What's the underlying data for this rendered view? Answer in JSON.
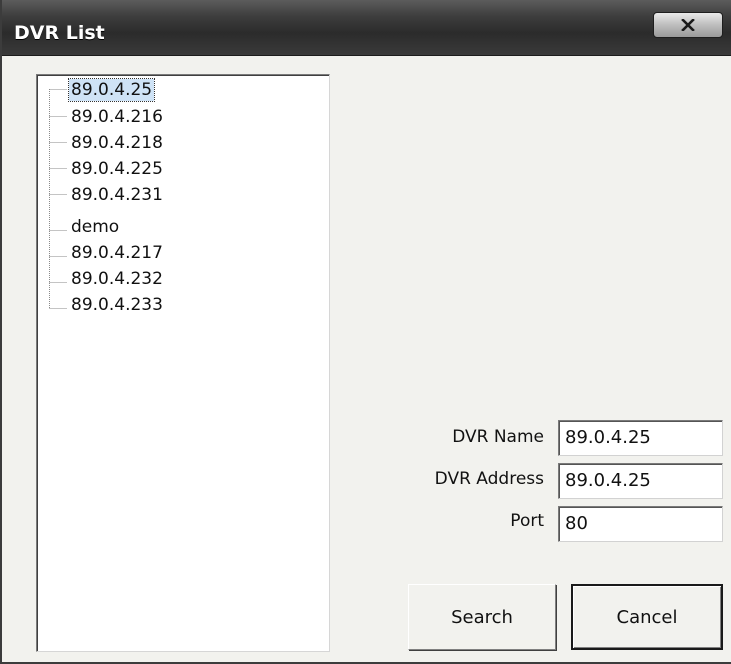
{
  "window": {
    "title": "DVR List",
    "close_label": "x"
  },
  "tree": {
    "items": [
      {
        "label": "89.0.4.25",
        "selected": true
      },
      {
        "label": "89.0.4.216",
        "selected": false
      },
      {
        "label": "89.0.4.218",
        "selected": false
      },
      {
        "label": "89.0.4.225",
        "selected": false
      },
      {
        "label": "89.0.4.231",
        "selected": false
      },
      {
        "label": "demo",
        "selected": false
      },
      {
        "label": "89.0.4.217",
        "selected": false
      },
      {
        "label": "89.0.4.232",
        "selected": false
      },
      {
        "label": "89.0.4.233",
        "selected": false
      }
    ]
  },
  "form": {
    "name_label": "DVR Name",
    "name_value": "89.0.4.25",
    "address_label": "DVR Address",
    "address_value": "89.0.4.25",
    "port_label": "Port",
    "port_value": "80"
  },
  "buttons": {
    "search_label": "Search",
    "cancel_label": "Cancel"
  }
}
